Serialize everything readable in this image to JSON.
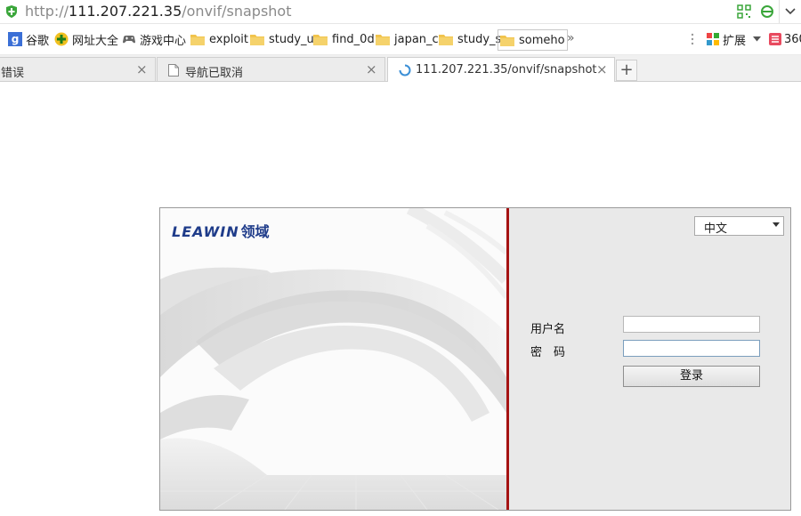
{
  "address_bar": {
    "url_scheme": "http://",
    "url_host": "111.207.221.35",
    "url_path": "/onvif/snapshot"
  },
  "bookmarks": {
    "items": [
      {
        "label": "谷歌",
        "icon": "google-icon"
      },
      {
        "label": "网址大全",
        "icon": "web-directory-icon"
      },
      {
        "label": "游戏中心",
        "icon": "gamepad-icon"
      },
      {
        "label": "exploit",
        "icon": "folder-icon"
      },
      {
        "label": "study_u",
        "icon": "folder-icon"
      },
      {
        "label": "find_0d",
        "icon": "folder-icon"
      },
      {
        "label": "japan_c",
        "icon": "folder-icon"
      },
      {
        "label": "study_s",
        "icon": "folder-icon"
      },
      {
        "label": "someho",
        "icon": "folder-icon"
      }
    ],
    "more_glyph": "»",
    "extensions_label": "扩展",
    "partial_label": "360"
  },
  "tabs": [
    {
      "title": "错误",
      "close": "×"
    },
    {
      "title": "导航已取消",
      "close": "×"
    },
    {
      "title": "111.207.221.35/onvif/snapshot",
      "close": "×"
    }
  ],
  "new_tab_glyph": "+",
  "login": {
    "logo_latin": "LEAWIN",
    "logo_cn": "领域",
    "language": {
      "selected": "中文"
    },
    "username_label": "用户名",
    "password_label": "密　码",
    "username_value": "",
    "password_value": "",
    "submit_label": "登录"
  },
  "colors": {
    "divider": "#a51313",
    "logo": "#1f3c8a",
    "form_bg": "#e9e9e9"
  }
}
